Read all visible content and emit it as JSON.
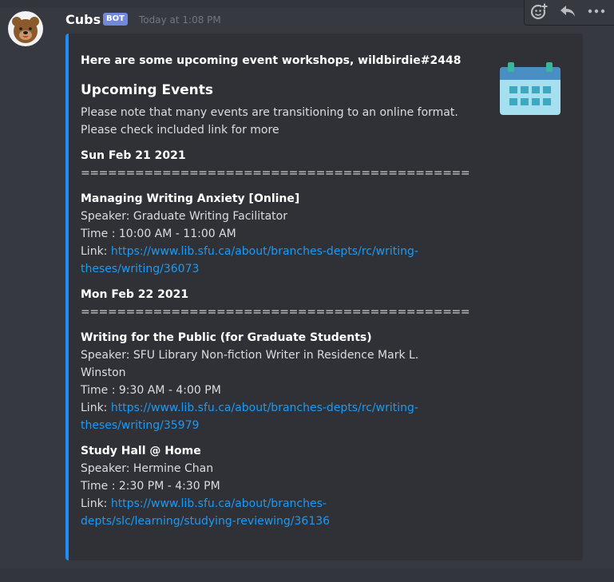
{
  "message": {
    "author": "Cubs",
    "bot_tag": "BOT",
    "timestamp": "Today at 1:08 PM"
  },
  "toolbar": {
    "icons": [
      "add-reaction-icon",
      "reply-icon",
      "more-icon"
    ]
  },
  "embed": {
    "accent_color": "#1d8ef7",
    "author_line": "Here are some upcoming event workshops, wildbirdie#2448",
    "title": "Upcoming Events",
    "description_line1": "Please note that many events are transitioning to an online format.",
    "description_line2": "Please check included link for more",
    "thumbnail_icon": "calendar-icon",
    "days": [
      {
        "date": "Sun Feb 21 2021",
        "rule": "===========================================",
        "events": [
          {
            "name": "Managing Writing Anxiety [Online]",
            "speaker": "Speaker: Graduate Writing Facilitator",
            "time": "Time : 10:00 AM - 11:00 AM",
            "link_label": "Link: ",
            "link_line1": "https://www.lib.sfu.ca/about/branches-depts/rc/writing-",
            "link_line2": "theses/writing/36073"
          }
        ]
      },
      {
        "date": "Mon Feb 22 2021",
        "rule": "===========================================",
        "events": [
          {
            "name": "Writing for the Public (for Graduate Students)",
            "speaker_line1": "Speaker: SFU Library Non-fiction Writer in Residence Mark L.",
            "speaker_line2": "Winston",
            "time": "Time : 9:30 AM - 4:00 PM",
            "link_label": "Link: ",
            "link_line1": "https://www.lib.sfu.ca/about/branches-depts/rc/writing-",
            "link_line2": "theses/writing/35979"
          },
          {
            "name": "Study Hall @ Home",
            "speaker": "Speaker: Hermine Chan",
            "time": "Time : 2:30 PM - 4:30 PM",
            "link_label": "Link: ",
            "link_line1": "https://www.lib.sfu.ca/about/branches-",
            "link_line2": "depts/slc/learning/studying-reviewing/36136"
          }
        ]
      }
    ]
  }
}
